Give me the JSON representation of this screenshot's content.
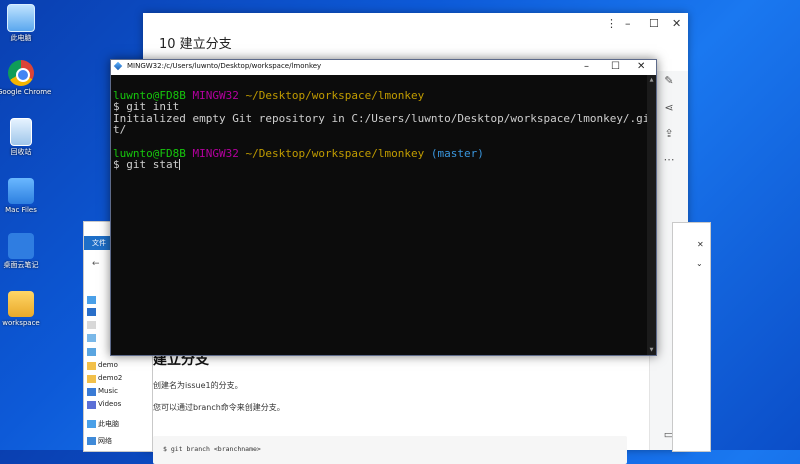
{
  "desktop": {
    "icons": [
      {
        "label": "此电脑",
        "icon": "computer-icon"
      },
      {
        "label": "Google Chrome",
        "icon": "chrome-icon"
      },
      {
        "label": "回收站",
        "icon": "recycle-bin-icon"
      },
      {
        "label": "Mac Files",
        "icon": "folder-icon"
      },
      {
        "label": "桌面云笔记",
        "icon": "note-icon"
      },
      {
        "label": "workspace",
        "icon": "folder-icon"
      }
    ]
  },
  "document_window": {
    "title": "10 建立分支",
    "heading": "建立分支",
    "para1": "创建名为issue1的分支。",
    "para2": "您可以通过branch命令来创建分支。",
    "code": "$ git branch <branchname>"
  },
  "explorer": {
    "file_tab": "文件",
    "items": [
      "demo",
      "demo2",
      "Music",
      "Videos",
      "此电脑",
      "网络"
    ]
  },
  "terminal": {
    "title": "MINGW32:/c/Users/luwnto/Desktop/workspace/lmonkey",
    "prompt1": {
      "user": "luwnto@FD8B",
      "sys": "MINGW32",
      "path": "~/Desktop/workspace/lmonkey"
    },
    "cmd1": "$ git init",
    "out1a": "Initialized empty Git repository in C:/Users/luwnto/Desktop/workspace/lmonkey/.gi",
    "out1b": "t/",
    "prompt2": {
      "user": "luwnto@FD8B",
      "sys": "MINGW32",
      "path": "~/Desktop/workspace/lmonkey",
      "branch": "(master)"
    },
    "cmd2": "$ git stat"
  },
  "colors": {
    "prompt_user": "#16c60c",
    "prompt_sys": "#b4009e",
    "prompt_path": "#c19c00",
    "branch": "#3a96dd"
  }
}
